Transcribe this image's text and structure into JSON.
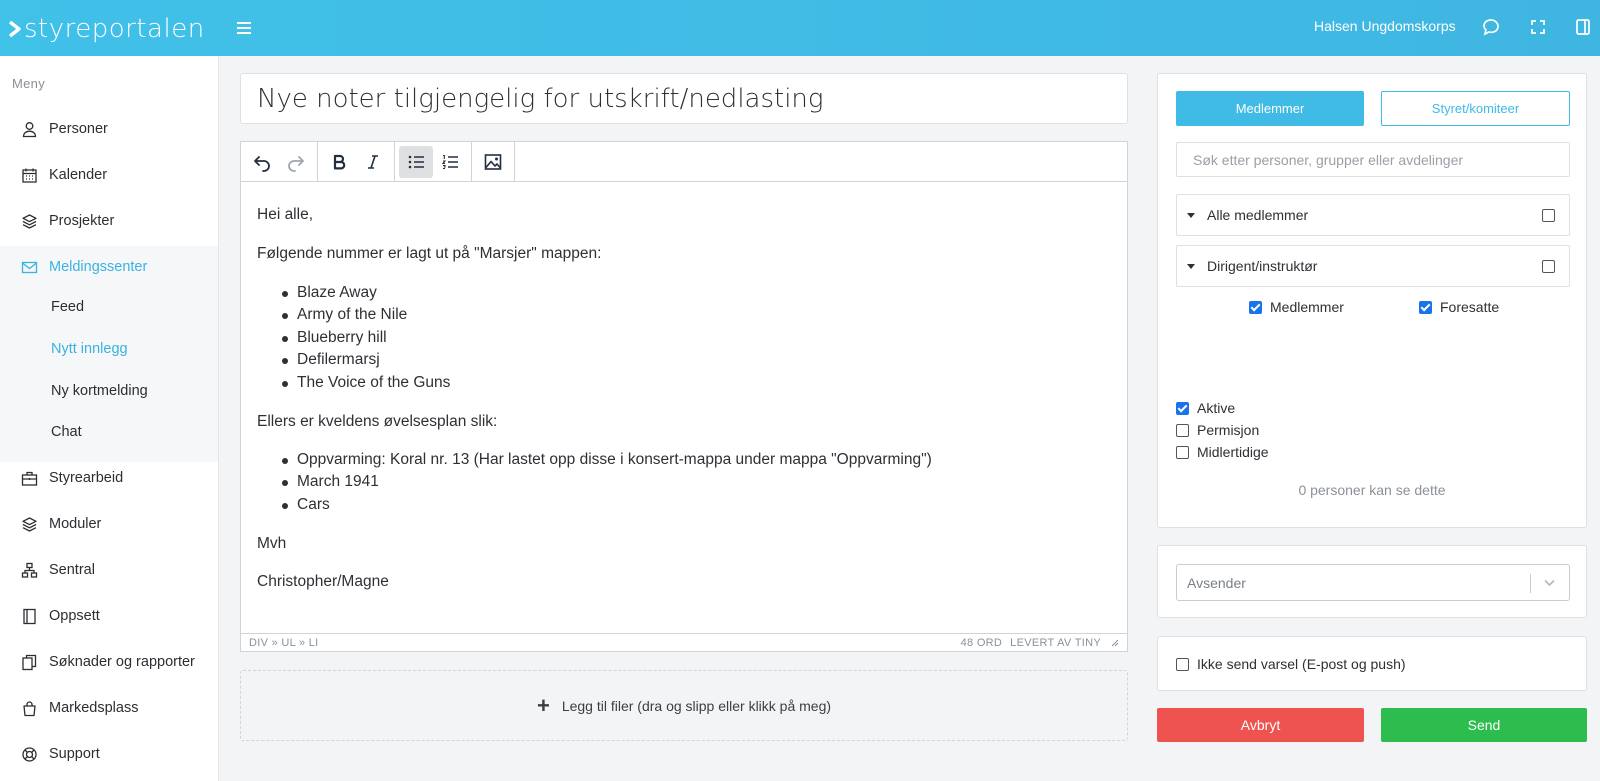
{
  "app": {
    "logo_text": "styreportalen",
    "org_name": "Halsen Ungdomskorps"
  },
  "topbar": {
    "icons": [
      "menu-icon",
      "chat-icon",
      "fullscreen-icon",
      "panel-icon"
    ]
  },
  "sidebar": {
    "title": "Meny",
    "items": [
      {
        "label": "Personer",
        "icon": "person-icon"
      },
      {
        "label": "Kalender",
        "icon": "calendar-icon"
      },
      {
        "label": "Prosjekter",
        "icon": "layers-icon"
      },
      {
        "label": "Meldingssenter",
        "icon": "mail-icon",
        "active": true
      },
      {
        "label": "Styrearbeid",
        "icon": "briefcase-icon"
      },
      {
        "label": "Moduler",
        "icon": "layers-icon"
      },
      {
        "label": "Sentral",
        "icon": "sitemap-icon"
      },
      {
        "label": "Oppsett",
        "icon": "book-icon"
      },
      {
        "label": "Søknader og rapporter",
        "icon": "documents-icon"
      },
      {
        "label": "Markedsplass",
        "icon": "bag-icon"
      },
      {
        "label": "Support",
        "icon": "lifebuoy-icon"
      }
    ],
    "submenu": [
      {
        "label": "Feed"
      },
      {
        "label": "Nytt innlegg",
        "active": true
      },
      {
        "label": "Ny kortmelding"
      },
      {
        "label": "Chat"
      }
    ]
  },
  "post": {
    "title": "Nye noter tilgjengelig for utskrift/nedlasting",
    "body": {
      "greeting": "Hei alle,",
      "intro": "Følgende nummer er lagt ut på \"Marsjer\" mappen:",
      "list1": [
        "Blaze Away",
        "Army of the Nile",
        "Blueberry hill",
        "Defilermarsj",
        "The Voice of the Guns"
      ],
      "middle": "Ellers er kveldens øvelsesplan slik:",
      "list2": [
        "Oppvarming: Koral nr. 13 (Har lastet opp disse i konsert-mappa under mappa \"Oppvarming\")",
        "March 1941",
        "Cars"
      ],
      "closing": "Mvh",
      "signature": "Christopher/Magne"
    }
  },
  "editor": {
    "path": "DIV » UL » LI",
    "word_count": "48 ORD",
    "powered_by": "LEVERT AV TINY"
  },
  "dropzone": {
    "label": "Legg til filer (dra og slipp eller klikk på meg)"
  },
  "recipients": {
    "tabs": {
      "members": "Medlemmer",
      "board": "Styret/komiteer"
    },
    "search_placeholder": "Søk etter personer, grupper eller avdelinger",
    "groups": [
      {
        "label": "Alle medlemmer",
        "checked": false
      },
      {
        "label": "Dirigent/instruktør",
        "checked": false
      }
    ],
    "sub_options": [
      {
        "label": "Medlemmer",
        "checked": true
      },
      {
        "label": "Foresatte",
        "checked": true
      }
    ],
    "status_filters": [
      {
        "label": "Aktive",
        "checked": true
      },
      {
        "label": "Permisjon",
        "checked": false
      },
      {
        "label": "Midlertidige",
        "checked": false
      }
    ],
    "visibility_text": "0 personer kan se dette"
  },
  "sender": {
    "placeholder": "Avsender"
  },
  "notify": {
    "label": "Ikke send varsel (E-post og push)",
    "checked": false
  },
  "actions": {
    "cancel": "Avbryt",
    "send": "Send"
  },
  "colors": {
    "brand": "#40c1e8",
    "cancel": "#ef5350",
    "send": "#2dbd4e",
    "active_nav": "#3bb3df"
  }
}
